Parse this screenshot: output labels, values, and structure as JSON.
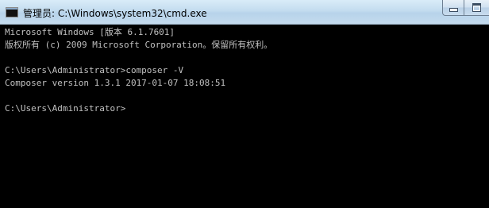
{
  "window": {
    "title": "管理员: C:\\Windows\\system32\\cmd.exe",
    "icon": "cmd-icon",
    "buttons": {
      "minimize": "minimize-icon",
      "maximize": "maximize-icon"
    }
  },
  "console": {
    "lines": [
      "Microsoft Windows [版本 6.1.7601]",
      "版权所有 (c) 2009 Microsoft Corporation。保留所有权利。",
      "C:\\Users\\Administrator>composer -V",
      "Composer version 1.3.1 2017-01-07 18:08:51",
      "C:\\Users\\Administrator>"
    ]
  },
  "colors": {
    "console_background": "#000000",
    "console_text": "#c0c0c0",
    "titlebar": "#c3dcef"
  }
}
